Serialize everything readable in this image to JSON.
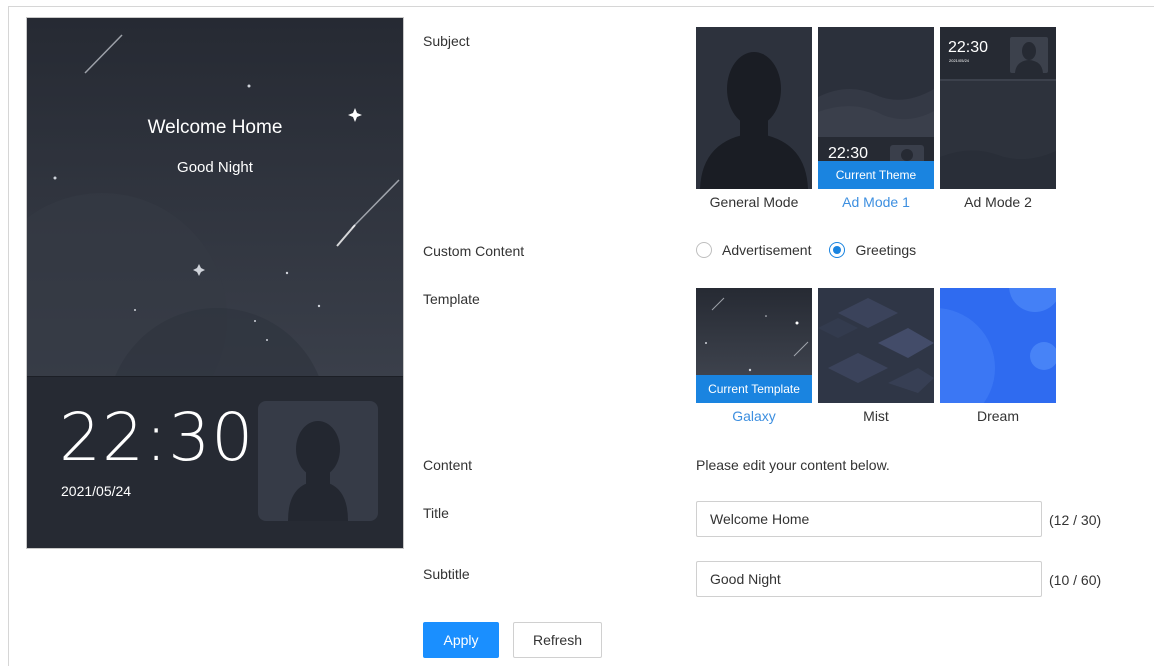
{
  "preview": {
    "title": "Welcome Home",
    "subtitle": "Good Night",
    "time": "22:30",
    "date": "2021/05/24"
  },
  "labels": {
    "subject": "Subject",
    "custom_content": "Custom Content",
    "template": "Template",
    "content": "Content",
    "title": "Title",
    "subtitle": "Subtitle"
  },
  "themes": [
    {
      "name": "General Mode",
      "active": false
    },
    {
      "name": "Ad Mode 1",
      "active": true,
      "badge": "Current Theme",
      "time": "22:30"
    },
    {
      "name": "Ad Mode 2",
      "active": false,
      "time": "22:30",
      "date": "2021/05/24"
    }
  ],
  "custom_content": {
    "options": [
      "Advertisement",
      "Greetings"
    ],
    "selected": "Greetings"
  },
  "templates": [
    {
      "name": "Galaxy",
      "active": true,
      "badge": "Current Template"
    },
    {
      "name": "Mist",
      "active": false
    },
    {
      "name": "Dream",
      "active": false
    }
  ],
  "content_hint": "Please edit your content below.",
  "form": {
    "title_value": "Welcome Home",
    "title_counter": "(12 / 30)",
    "subtitle_value": "Good Night",
    "subtitle_counter": "(10 / 60)"
  },
  "buttons": {
    "apply": "Apply",
    "refresh": "Refresh"
  },
  "colors": {
    "accent": "#1a8fff",
    "current_badge": "#1a84e0",
    "active_caption": "#3d8fe0"
  }
}
